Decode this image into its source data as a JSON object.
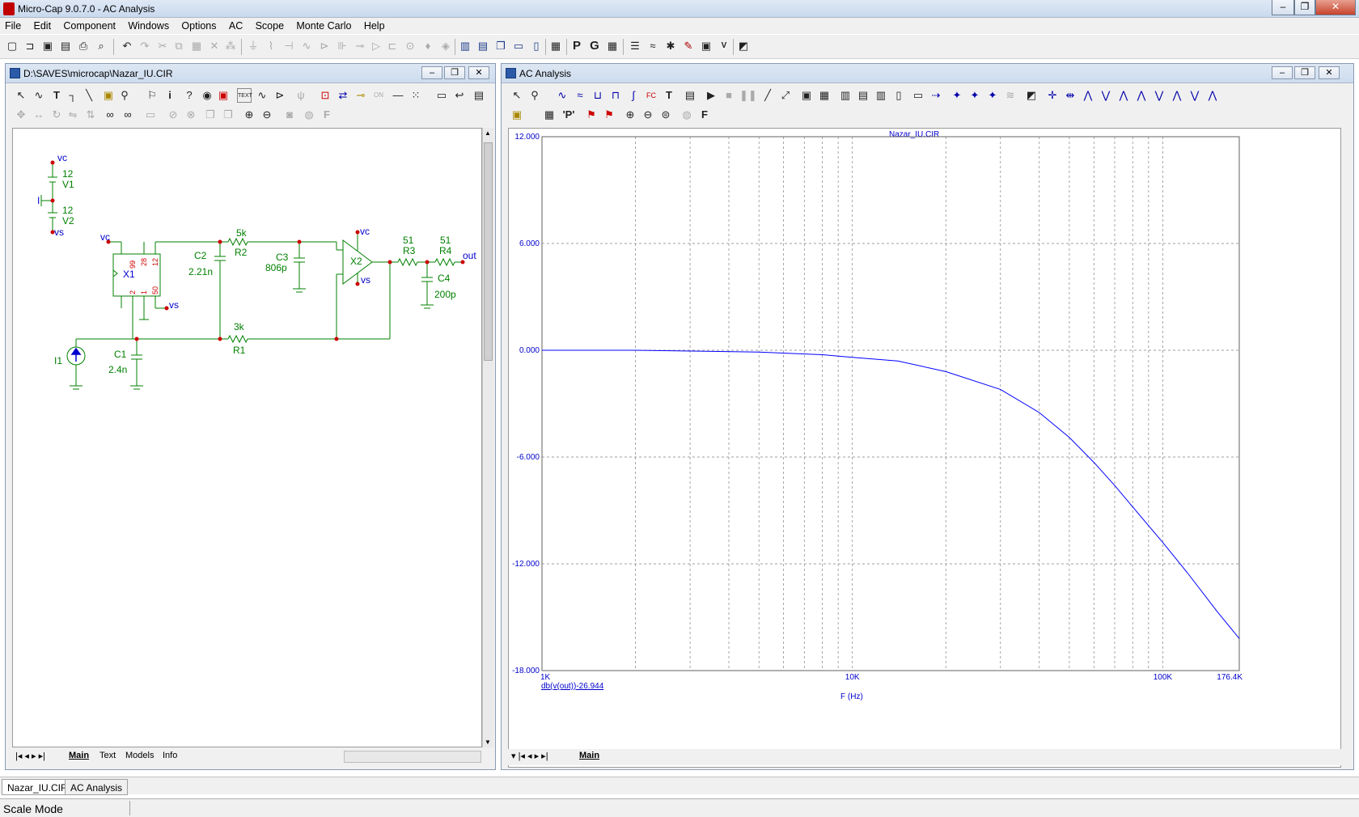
{
  "app": {
    "title": "Micro-Cap 9.0.7.0 - AC Analysis",
    "window_controls": [
      "–",
      "❐",
      "✕"
    ]
  },
  "menu": [
    "File",
    "Edit",
    "Component",
    "Windows",
    "Options",
    "AC",
    "Scope",
    "Monte Carlo",
    "Help"
  ],
  "toolbar_icons": [
    "new-file-icon",
    "open-icon",
    "save-icon",
    "save-all-icon",
    "print-icon",
    "print-preview-icon",
    "undo-icon",
    "redo-icon",
    "cut-icon",
    "copy-icon",
    "paste-icon",
    "delete-icon",
    "tile-vertical-icon",
    "tile-horizontal-icon",
    "cascade-icon",
    "calculator-icon",
    "P",
    "G"
  ],
  "schematic_window": {
    "title": "D:\\SAVES\\microcap\\Nazar_IU.CIR",
    "tabs": [
      "Main",
      "Text",
      "Models",
      "Info"
    ],
    "active_tab": "Main",
    "components": {
      "vc_top": "vc",
      "V1_value": "12",
      "V1_name": "V1",
      "V2_value": "12",
      "V2_name": "V2",
      "vs_left": "vs",
      "I_node": "I",
      "vc_x1": "vc",
      "X1_name": "X1",
      "X1_pins": [
        "99",
        "28",
        "12",
        "2",
        "1",
        "50"
      ],
      "vs_x1": "vs",
      "C2_name": "C2",
      "C2_value": "2.21n",
      "R2_value": "5k",
      "R2_name": "R2",
      "C3_name": "C3",
      "C3_value": "806p",
      "vc_x2": "vc",
      "X2_name": "X2",
      "vs_x2": "vs",
      "R3_value": "51",
      "R3_name": "R3",
      "R4_value": "51",
      "R4_name": "R4",
      "out": "out",
      "C4_name": "C4",
      "C4_value": "200p",
      "R1_value": "3k",
      "R1_name": "R1",
      "I1_name": "I1",
      "C1_name": "C1",
      "C1_value": "2.4n"
    }
  },
  "analysis_window": {
    "title": "AC Analysis",
    "tab": "Main",
    "plot_title": "Nazar_IU.CIR",
    "trace_label": "db(v(out))-26.944",
    "x_axis_title": "F (Hz)",
    "colors": {
      "trace": "#0000ff",
      "grid": "#808080",
      "labels": "#0000cc"
    }
  },
  "chart_data": {
    "type": "line",
    "title": "Nazar_IU.CIR",
    "xlabel": "F (Hz)",
    "ylabel": "",
    "x_scale": "log",
    "xlim": [
      1000,
      176400
    ],
    "ylim": [
      -18,
      12
    ],
    "x_tick_labels": [
      "1K",
      "10K",
      "100K",
      "176.4K"
    ],
    "y_tick_labels": [
      "12.000",
      "6.000",
      "0.000",
      "-6.000",
      "-12.000",
      "-18.000"
    ],
    "y_ticks": [
      12,
      6,
      0,
      -6,
      -12,
      -18
    ],
    "grid": true,
    "series": [
      {
        "name": "db(v(out))-26.944",
        "x": [
          1000,
          2000,
          5000,
          8000,
          10000,
          14000,
          20000,
          30000,
          40000,
          50000,
          60000,
          70000,
          80000,
          100000,
          120000,
          150000,
          176400
        ],
        "y": [
          0.0,
          0.0,
          -0.1,
          -0.25,
          -0.4,
          -0.6,
          -1.2,
          -2.2,
          -3.5,
          -4.9,
          -6.3,
          -7.6,
          -8.8,
          -10.8,
          -12.5,
          -14.7,
          -16.2
        ]
      }
    ]
  },
  "bottom_tabs": [
    "Nazar_IU.CIR",
    "AC Analysis"
  ],
  "status": "Scale Mode"
}
